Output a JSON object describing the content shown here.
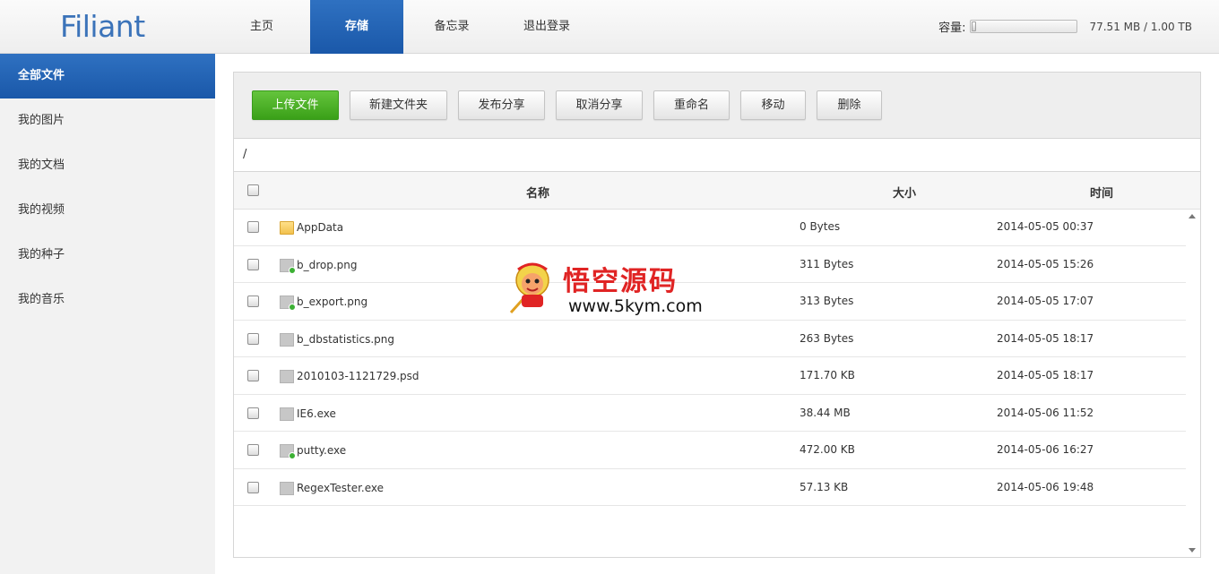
{
  "app": {
    "logo": "Filiant"
  },
  "nav": {
    "items": [
      {
        "label": "主页"
      },
      {
        "label": "存储"
      },
      {
        "label": "备忘录"
      },
      {
        "label": "退出登录"
      }
    ],
    "active_index": 1
  },
  "capacity": {
    "label": "容量:",
    "usage_text": "77.51 MB / 1.00 TB",
    "used_fraction": 0.0001
  },
  "sidebar": {
    "items": [
      {
        "label": "全部文件"
      },
      {
        "label": "我的图片"
      },
      {
        "label": "我的文档"
      },
      {
        "label": "我的视频"
      },
      {
        "label": "我的种子"
      },
      {
        "label": "我的音乐"
      }
    ],
    "active_index": 0
  },
  "toolbar": {
    "upload": "上传文件",
    "new_folder": "新建文件夹",
    "share": "发布分享",
    "unshare": "取消分享",
    "rename": "重命名",
    "move": "移动",
    "delete": "删除"
  },
  "path": "/",
  "table": {
    "headers": {
      "name": "名称",
      "size": "大小",
      "time": "时间"
    },
    "rows": [
      {
        "name": "AppData",
        "size": "0 Bytes",
        "time": "2014-05-05 00:37",
        "icon": "folder-icon"
      },
      {
        "name": "b_drop.png",
        "size": "311 Bytes",
        "time": "2014-05-05 15:26",
        "icon": "shared-file-icon"
      },
      {
        "name": "b_export.png",
        "size": "313 Bytes",
        "time": "2014-05-05 17:07",
        "icon": "shared-file-icon"
      },
      {
        "name": "b_dbstatistics.png",
        "size": "263 Bytes",
        "time": "2014-05-05 18:17",
        "icon": "file-icon"
      },
      {
        "name": "2010103-1121729.psd",
        "size": "171.70 KB",
        "time": "2014-05-05 18:17",
        "icon": "file-icon"
      },
      {
        "name": "IE6.exe",
        "size": "38.44 MB",
        "time": "2014-05-06 11:52",
        "icon": "file-icon"
      },
      {
        "name": "putty.exe",
        "size": "472.00 KB",
        "time": "2014-05-06 16:27",
        "icon": "shared-file-icon"
      },
      {
        "name": "RegexTester.exe",
        "size": "57.13 KB",
        "time": "2014-05-06 19:48",
        "icon": "file-icon"
      }
    ]
  },
  "watermark": {
    "title": "悟空源码",
    "url": "www.5kym.com"
  },
  "colors": {
    "accent": "#2565b8",
    "upload_green": "#4cb228",
    "logo_blue": "#3b73b9",
    "watermark_red": "#e02424"
  }
}
